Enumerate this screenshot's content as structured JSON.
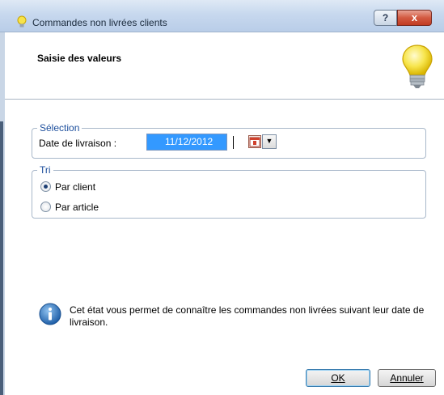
{
  "window": {
    "title": "Commandes non livrées clients",
    "help_label": "?",
    "close_label": "x"
  },
  "header": {
    "title": "Saisie des valeurs"
  },
  "selection": {
    "legend": "Sélection",
    "date_label": "Date de livraison :",
    "date_value": "11/12/2012"
  },
  "sort": {
    "legend": "Tri",
    "options": [
      {
        "label": "Par client",
        "checked": true
      },
      {
        "label": "Par article",
        "checked": false
      }
    ]
  },
  "info": {
    "text": "Cet état vous permet de connaître les commandes non livrées suivant leur date de livraison."
  },
  "buttons": {
    "ok_label": "OK",
    "cancel_label": "Annuler"
  },
  "icons": {
    "title": "lightbulb-icon",
    "header": "lightbulb-icon",
    "calendar": "calendar-icon",
    "dropdown": "chevron-down-icon",
    "info": "info-icon"
  },
  "colors": {
    "legend_text": "#1c4e9c",
    "selection_highlight": "#3399ff",
    "close_button": "#c13b22"
  }
}
